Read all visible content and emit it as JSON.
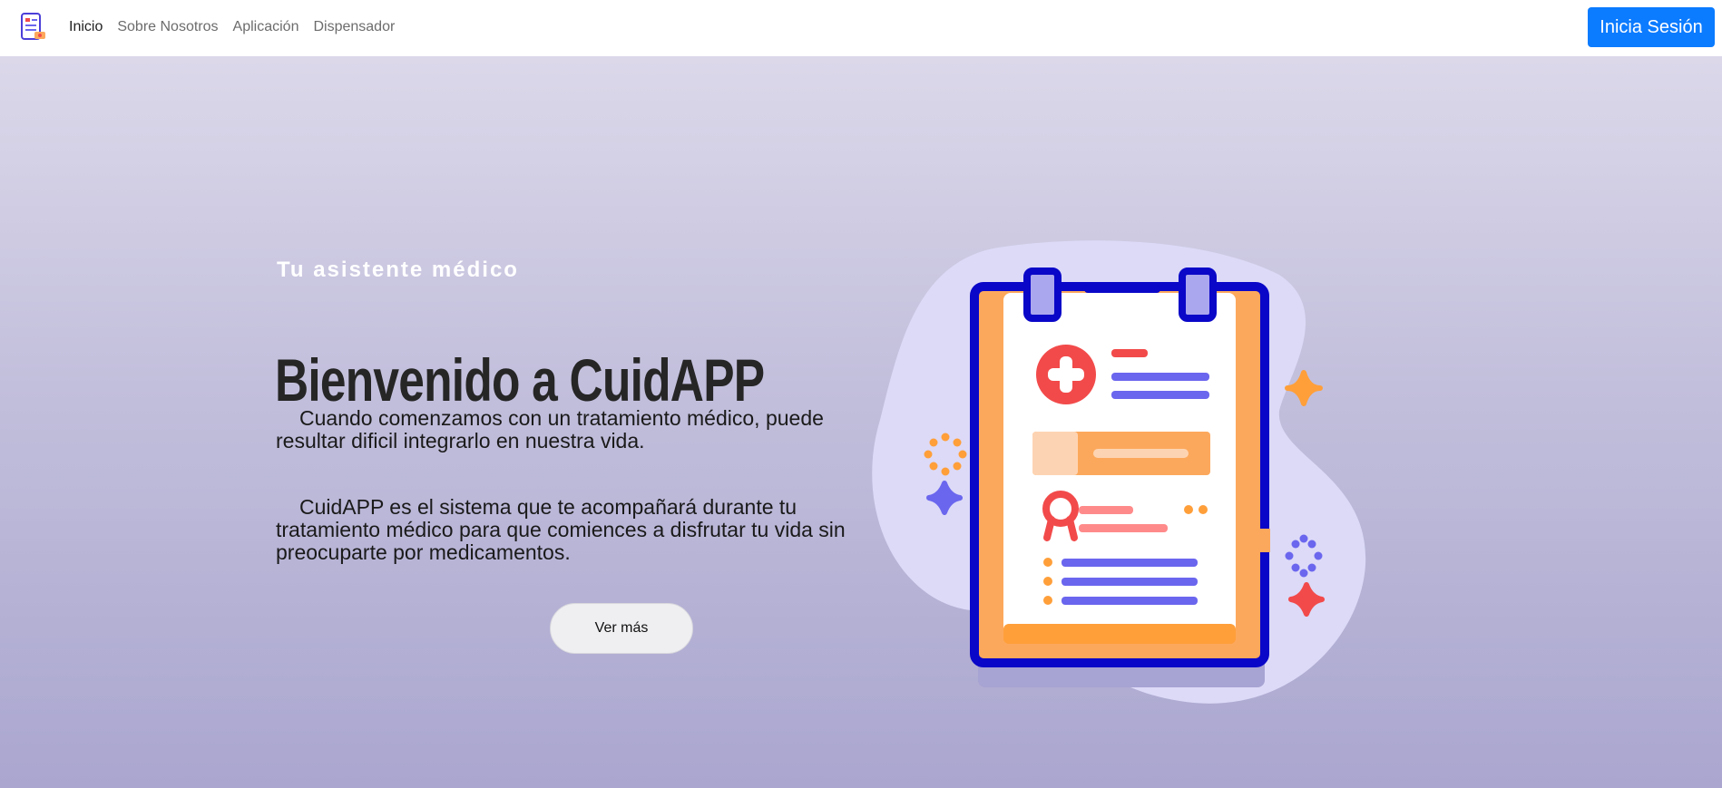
{
  "nav": {
    "links": [
      {
        "label": "Inicio"
      },
      {
        "label": "Sobre Nosotros"
      },
      {
        "label": "Aplicación"
      },
      {
        "label": "Dispensador"
      }
    ],
    "login_label": "Inicia Sesión"
  },
  "hero": {
    "subtitle": "Tu asistente médico",
    "title": "Bienvenido a CuidAPP",
    "paragraph1": "Cuando comenzamos con un tratamiento médico, puede resultar dificil integrarlo en nuestra vida.",
    "paragraph2": "CuidAPP es el sistema que te acompañará durante tu tratamiento médico para que comiences a disfrutar tu vida sin preocuparte por medicamentos.",
    "button_label": "Ver más"
  },
  "colors": {
    "primary": "#0b7bff",
    "hero_top": "#dcd8ea",
    "hero_bottom": "#aaa6cf",
    "clipboard_border": "#0a07c8",
    "clipboard_orange": "#fca85c",
    "accent_red": "#f24a4a",
    "accent_purple": "#6b66ee"
  },
  "icons": {
    "brand": "medical-app-logo-icon",
    "illustration": "medical-clipboard-illustration"
  }
}
